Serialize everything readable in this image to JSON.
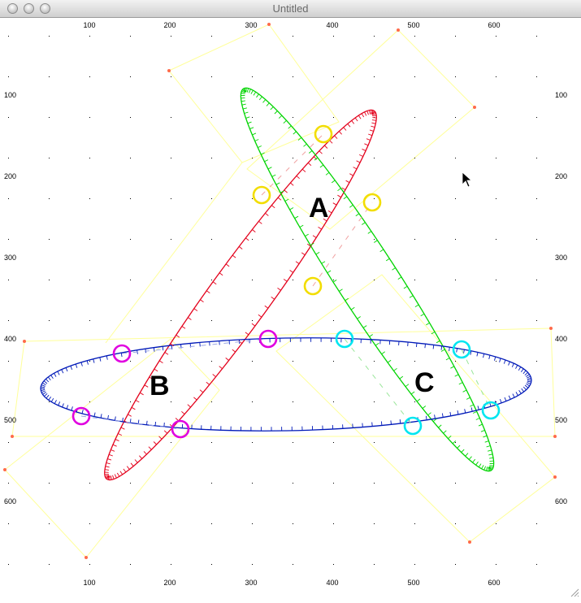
{
  "window": {
    "title": "Untitled"
  },
  "axes": {
    "x_labels": [
      "100",
      "200",
      "300",
      "400",
      "500",
      "600"
    ],
    "y_labels": [
      "100",
      "200",
      "300",
      "400",
      "500",
      "600"
    ]
  },
  "regions": {
    "a": "A",
    "b": "B",
    "c": "C"
  },
  "colors": {
    "red_ellipse": "#e3001b",
    "green_ellipse": "#00d400",
    "blue_ellipse": "#0019b8",
    "guide": "#ffff99",
    "control_point": "#ff6a4a",
    "yellow_marker": "#f2dd00",
    "magenta_marker": "#e000e0",
    "cyan_marker": "#00e6f0"
  },
  "icons": [
    "close-icon",
    "minimize-icon",
    "zoom-icon",
    "cursor-arrow-icon",
    "resize-grip-icon"
  ]
}
